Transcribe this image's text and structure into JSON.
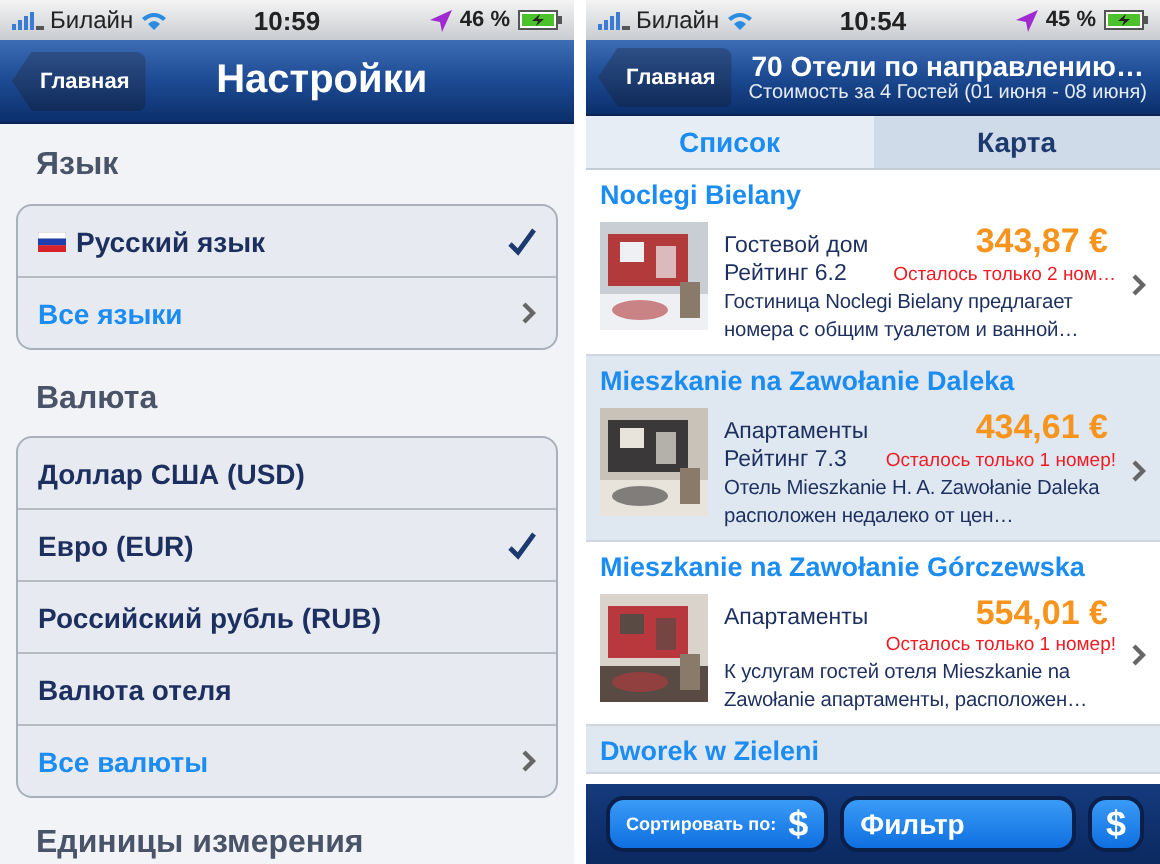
{
  "settings_screen": {
    "status_bar": {
      "carrier": "Билайн",
      "time": "10:59",
      "battery": "46 %"
    },
    "nav_bar": {
      "back": "Главная",
      "title": "Настройки"
    },
    "sections": [
      {
        "header": "Язык",
        "rows": [
          {
            "kind": "language",
            "label": "Русский язык",
            "checked": true
          },
          {
            "kind": "link",
            "label": "Все языки"
          }
        ]
      },
      {
        "header": "Валюта",
        "rows": [
          {
            "kind": "option",
            "label": "Доллар США (USD)",
            "checked": false
          },
          {
            "kind": "option",
            "label": "Евро (EUR)",
            "checked": true
          },
          {
            "kind": "option",
            "label": "Российский рубль (RUB)",
            "checked": false
          },
          {
            "kind": "option",
            "label": "Валюта отеля",
            "checked": false
          },
          {
            "kind": "link",
            "label": "Все валюты"
          }
        ]
      },
      {
        "header": "Единицы измерения"
      }
    ]
  },
  "hotels_screen": {
    "status_bar": {
      "carrier": "Билайн",
      "time": "10:54",
      "battery": "45 %"
    },
    "nav_bar": {
      "back": "Главная",
      "title": "70 Отели по направлению…",
      "subtitle": "Стоимость за 4 Гостей (01 июня - 08 июня)"
    },
    "tabs": [
      {
        "label": "Список",
        "selected": true
      },
      {
        "label": "Карта",
        "selected": false
      }
    ],
    "hotels": [
      {
        "name": "Noclegi Bielany",
        "type": "Гостевой дом",
        "rating": "Рейтинг 6.2",
        "price": "343,87 €",
        "availability": "Осталось только 2 ном…",
        "description": "Гостиница Noclegi Bielany предлагает номера с общим туалетом и ванной…"
      },
      {
        "name": "Mieszkanie na Zawołanie Daleka",
        "type": "Апартаменты",
        "rating": "Рейтинг 7.3",
        "price": "434,61 €",
        "availability": "Осталось только 1 номер!",
        "description": "Отель Mieszkanie H. A. Zawołanie Daleka расположен недалеко от цен…"
      },
      {
        "name": "Mieszkanie na Zawołanie Górczewska",
        "type": "Апартаменты",
        "price": "554,01 €",
        "availability": "Осталось только 1 номер!",
        "description": "К услугам гостей отеля Mieszkanie na Zawołanie апартаменты, расположен…"
      },
      {
        "name": "Dworek w Zieleni"
      }
    ],
    "toolbar": {
      "sort_label": "Сортировать по:",
      "sort_icon": "$",
      "filter": "Фильтр",
      "currency": "$"
    }
  }
}
